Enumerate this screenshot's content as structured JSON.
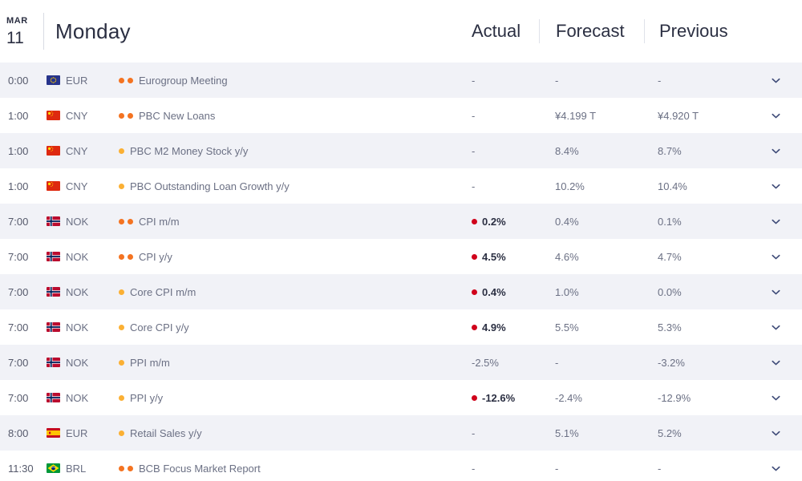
{
  "header": {
    "month": "MAR",
    "day_number": "11",
    "day_name": "Monday",
    "columns": {
      "actual": "Actual",
      "forecast": "Forecast",
      "previous": "Previous"
    }
  },
  "colors": {
    "impact_high": "#f47321",
    "impact_medium": "#fbb034",
    "actual_marker": "#d0021b",
    "row_alt_bg": "#f1f2f7",
    "text_primary": "#2b2f42",
    "text_muted": "#6b7084",
    "chevron": "#3d4a77"
  },
  "rows": [
    {
      "time": "0:00",
      "currency": "EUR",
      "flag": "eu-flag-icon",
      "impact": 2,
      "event": "Eurogroup Meeting",
      "actual": "-",
      "actual_marked": false,
      "forecast": "-",
      "previous": "-",
      "expand": "chevron-down-icon"
    },
    {
      "time": "1:00",
      "currency": "CNY",
      "flag": "cn-flag-icon",
      "impact": 2,
      "event": "PBC New Loans",
      "actual": "-",
      "actual_marked": false,
      "forecast": "¥4.199 T",
      "previous": "¥4.920 T",
      "expand": "chevron-down-icon"
    },
    {
      "time": "1:00",
      "currency": "CNY",
      "flag": "cn-flag-icon",
      "impact": 1,
      "event": "PBC M2 Money Stock y/y",
      "actual": "-",
      "actual_marked": false,
      "forecast": "8.4%",
      "previous": "8.7%",
      "expand": "chevron-down-icon"
    },
    {
      "time": "1:00",
      "currency": "CNY",
      "flag": "cn-flag-icon",
      "impact": 1,
      "event": "PBC Outstanding Loan Growth y/y",
      "actual": "-",
      "actual_marked": false,
      "forecast": "10.2%",
      "previous": "10.4%",
      "expand": "chevron-down-icon"
    },
    {
      "time": "7:00",
      "currency": "NOK",
      "flag": "no-flag-icon",
      "impact": 2,
      "event": "CPI m/m",
      "actual": "0.2%",
      "actual_marked": true,
      "forecast": "0.4%",
      "previous": "0.1%",
      "expand": "chevron-down-icon"
    },
    {
      "time": "7:00",
      "currency": "NOK",
      "flag": "no-flag-icon",
      "impact": 2,
      "event": "CPI y/y",
      "actual": "4.5%",
      "actual_marked": true,
      "forecast": "4.6%",
      "previous": "4.7%",
      "expand": "chevron-down-icon"
    },
    {
      "time": "7:00",
      "currency": "NOK",
      "flag": "no-flag-icon",
      "impact": 1,
      "event": "Core CPI m/m",
      "actual": "0.4%",
      "actual_marked": true,
      "forecast": "1.0%",
      "previous": "0.0%",
      "expand": "chevron-down-icon"
    },
    {
      "time": "7:00",
      "currency": "NOK",
      "flag": "no-flag-icon",
      "impact": 1,
      "event": "Core CPI y/y",
      "actual": "4.9%",
      "actual_marked": true,
      "forecast": "5.5%",
      "previous": "5.3%",
      "expand": "chevron-down-icon"
    },
    {
      "time": "7:00",
      "currency": "NOK",
      "flag": "no-flag-icon",
      "impact": 1,
      "event": "PPI m/m",
      "actual": "-2.5%",
      "actual_marked": false,
      "forecast": "-",
      "previous": "-3.2%",
      "expand": "chevron-down-icon"
    },
    {
      "time": "7:00",
      "currency": "NOK",
      "flag": "no-flag-icon",
      "impact": 1,
      "event": "PPI y/y",
      "actual": "-12.6%",
      "actual_marked": true,
      "forecast": "-2.4%",
      "previous": "-12.9%",
      "expand": "chevron-down-icon"
    },
    {
      "time": "8:00",
      "currency": "EUR",
      "flag": "es-flag-icon",
      "impact": 1,
      "event": "Retail Sales y/y",
      "actual": "-",
      "actual_marked": false,
      "forecast": "5.1%",
      "previous": "5.2%",
      "expand": "chevron-down-icon"
    },
    {
      "time": "11:30",
      "currency": "BRL",
      "flag": "br-flag-icon",
      "impact": 2,
      "event": "BCB Focus Market Report",
      "actual": "-",
      "actual_marked": false,
      "forecast": "-",
      "previous": "-",
      "expand": "chevron-down-icon"
    }
  ]
}
